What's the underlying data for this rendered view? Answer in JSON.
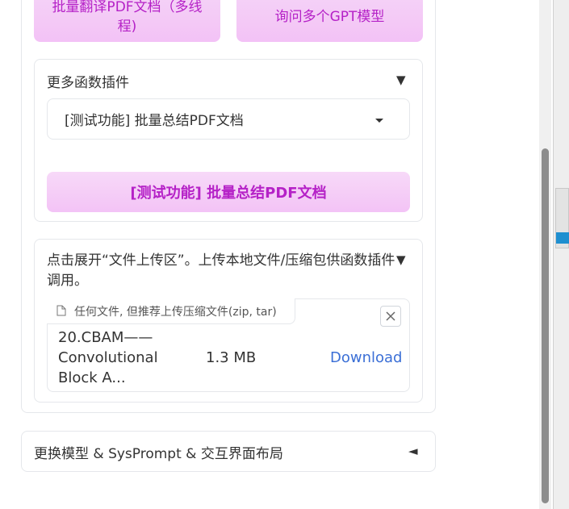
{
  "buttons": {
    "batch_translate": "批量翻译PDF文档（多线程)",
    "ask_gpt": "询问多个GPT模型"
  },
  "plugins": {
    "title": "更多函数插件",
    "arrow": "▼",
    "selected": "[测试功能] 批量总结PDF文档",
    "run_label": "[测试功能] 批量总结PDF文档"
  },
  "upload": {
    "title": "点击展开“文件上传区”。上传本地文件/压缩包供函数插件调用。",
    "arrow": "▼",
    "placeholder": "任何文件, 但推荐上传压缩文件(zip, tar)",
    "file": {
      "name": "20.CBAM——Convolutional Block A...",
      "size": "1.3 MB",
      "download": "Download"
    }
  },
  "model_section": {
    "title": "更换模型 & SysPrompt & 交互界面布局",
    "arrow": "◄"
  },
  "icons": {
    "file": "file-icon",
    "close": "close-icon",
    "caret": "caret-down-icon"
  }
}
